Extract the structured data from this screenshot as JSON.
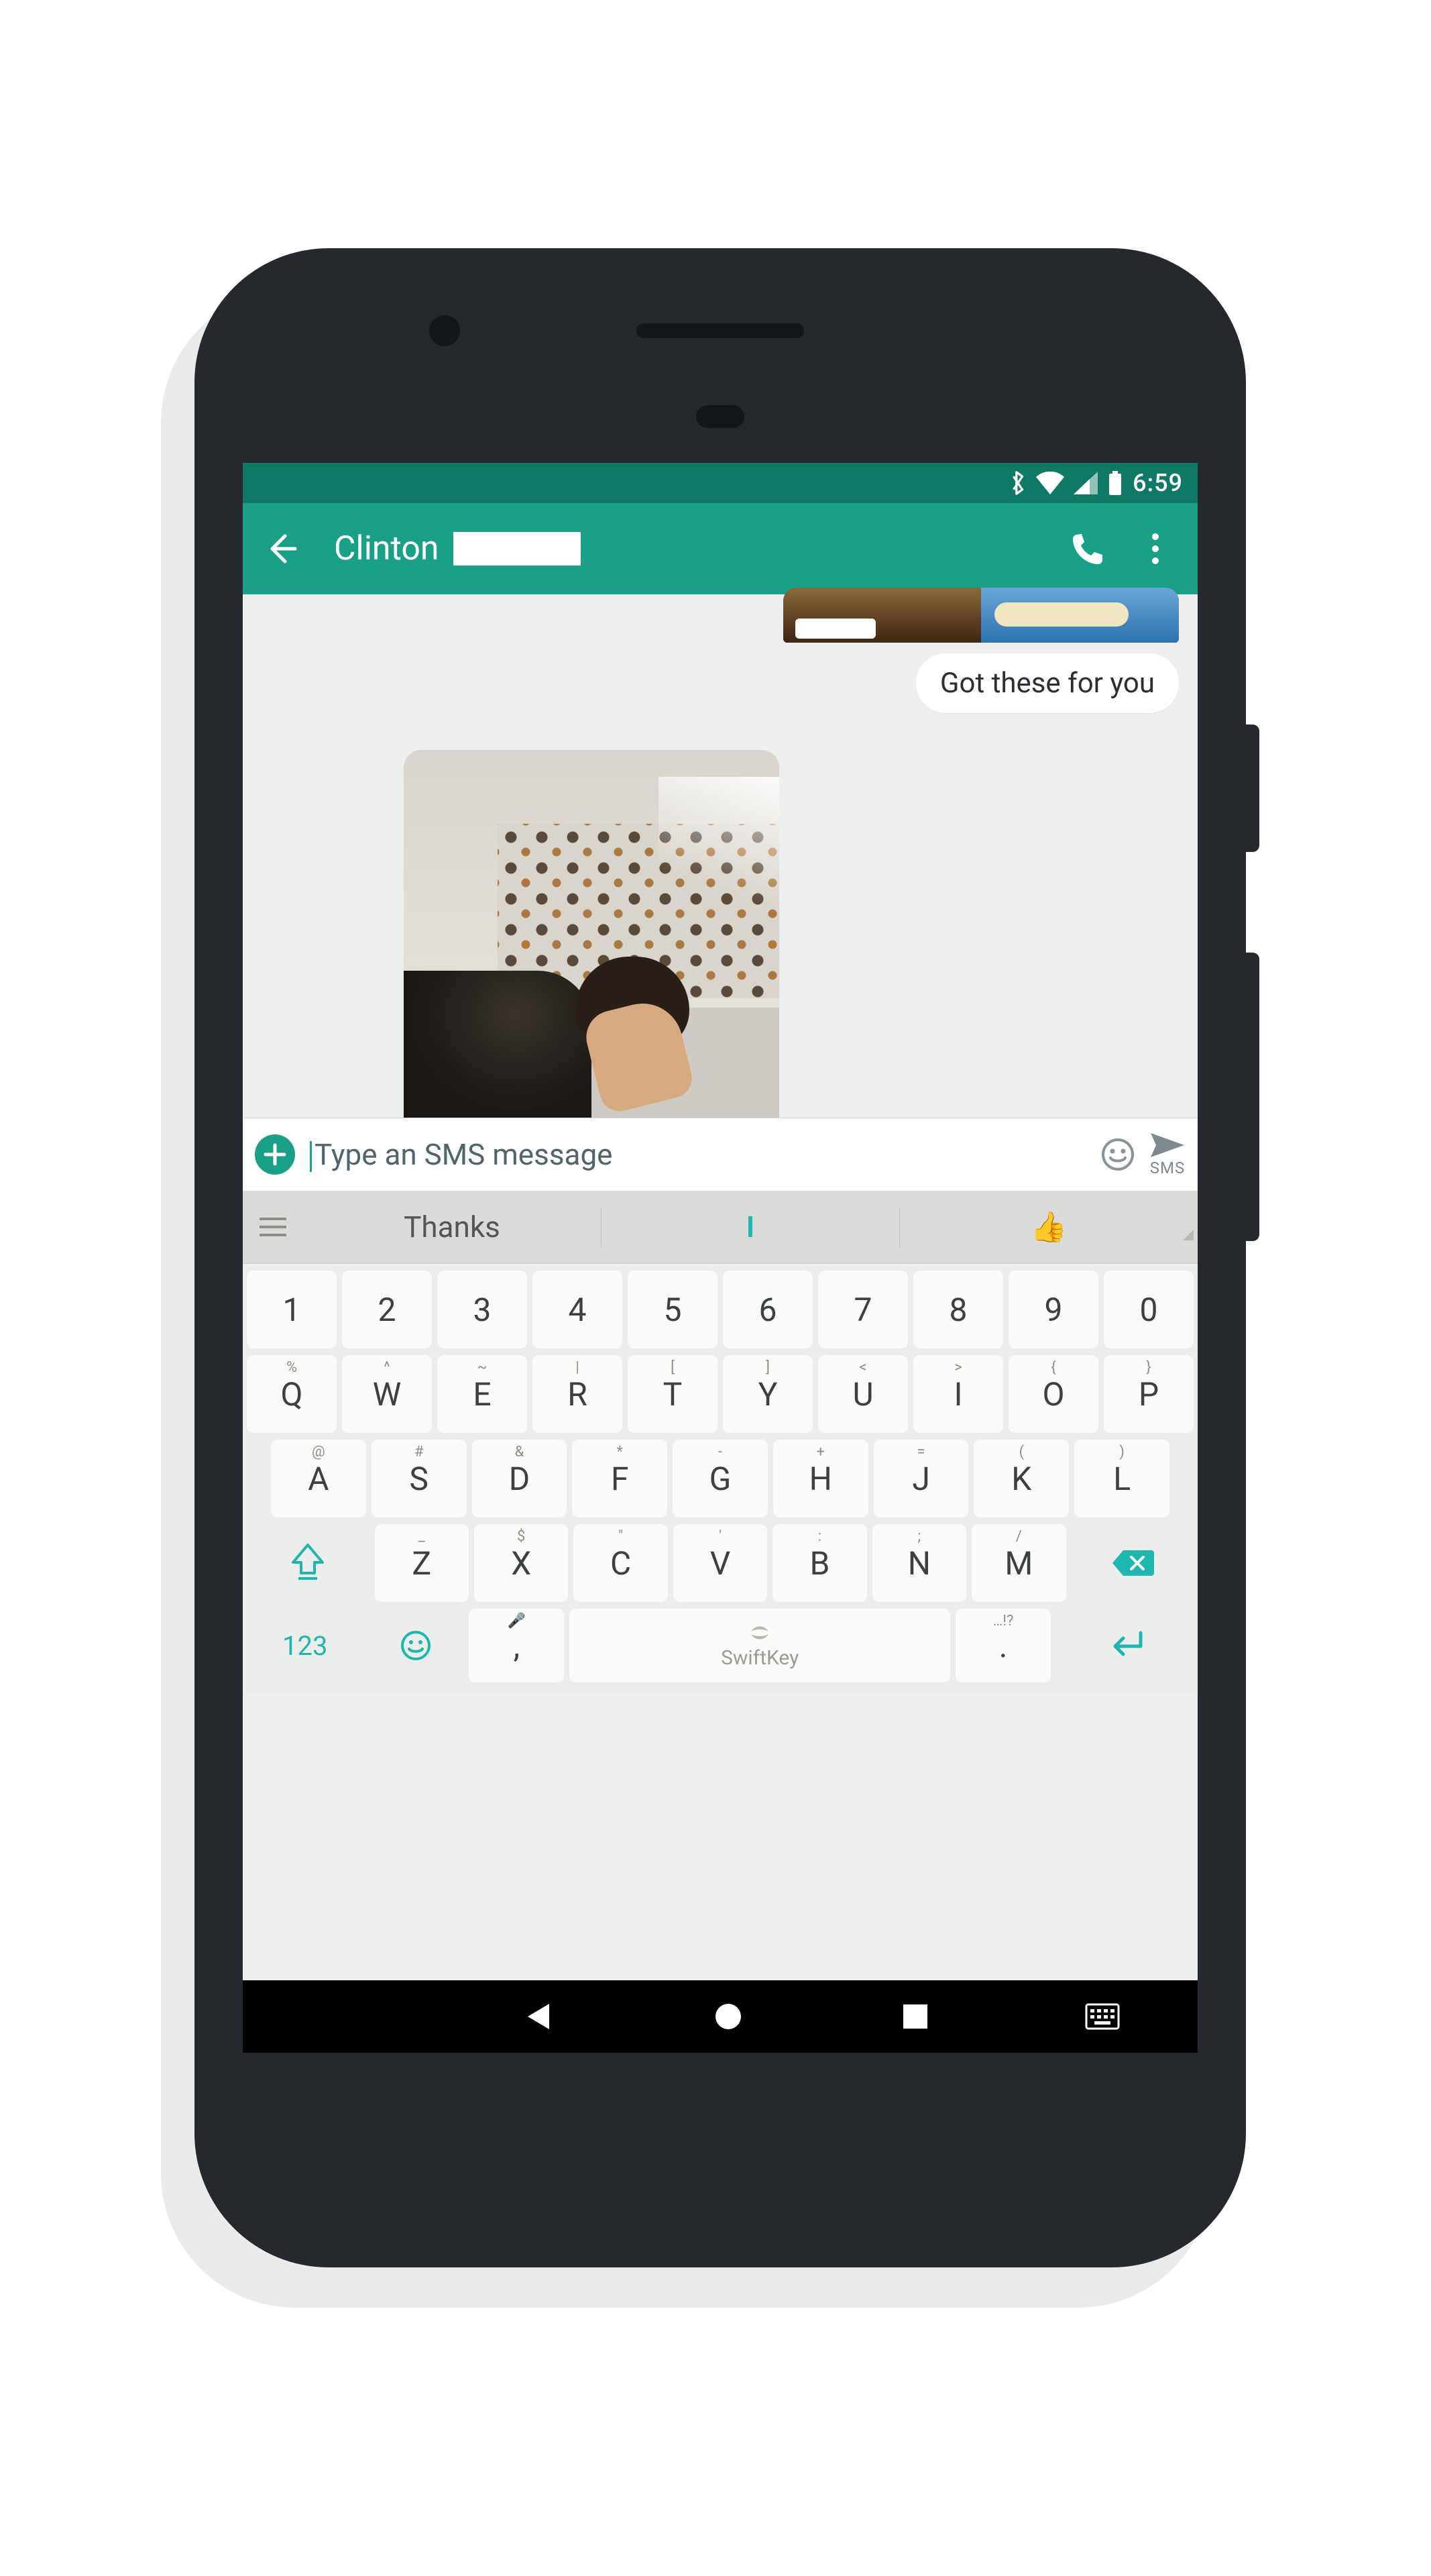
{
  "statusbar": {
    "time": "6:59"
  },
  "appbar": {
    "contact_name": "Clinton"
  },
  "conversation": {
    "sent_text": "Got these for you"
  },
  "composer": {
    "placeholder": "Type an SMS message",
    "send_label": "SMS"
  },
  "suggestions": {
    "left": "Thanks",
    "middle": "I",
    "right_emoji": "👍"
  },
  "keyboard": {
    "row_num": [
      "1",
      "2",
      "3",
      "4",
      "5",
      "6",
      "7",
      "8",
      "9",
      "0"
    ],
    "row1": [
      {
        "k": "Q",
        "h": "%"
      },
      {
        "k": "W",
        "h": "^"
      },
      {
        "k": "E",
        "h": "~"
      },
      {
        "k": "R",
        "h": "|"
      },
      {
        "k": "T",
        "h": "["
      },
      {
        "k": "Y",
        "h": "]"
      },
      {
        "k": "U",
        "h": "<"
      },
      {
        "k": "I",
        "h": ">"
      },
      {
        "k": "O",
        "h": "{"
      },
      {
        "k": "P",
        "h": "}"
      }
    ],
    "row2": [
      {
        "k": "A",
        "h": "@"
      },
      {
        "k": "S",
        "h": "#"
      },
      {
        "k": "D",
        "h": "&"
      },
      {
        "k": "F",
        "h": "*"
      },
      {
        "k": "G",
        "h": "-"
      },
      {
        "k": "H",
        "h": "+"
      },
      {
        "k": "J",
        "h": "="
      },
      {
        "k": "K",
        "h": "("
      },
      {
        "k": "L",
        "h": ")"
      }
    ],
    "row3": [
      {
        "k": "Z",
        "h": "_"
      },
      {
        "k": "X",
        "h": "$"
      },
      {
        "k": "C",
        "h": "\""
      },
      {
        "k": "V",
        "h": "'"
      },
      {
        "k": "B",
        "h": ":"
      },
      {
        "k": "N",
        "h": ";"
      },
      {
        "k": "M",
        "h": "/"
      }
    ],
    "mode_key": "123",
    "comma_hint": "🎤",
    "comma": ",",
    "space_brand": "SwiftKey",
    "period": ".",
    "period_hint": "…!?"
  }
}
